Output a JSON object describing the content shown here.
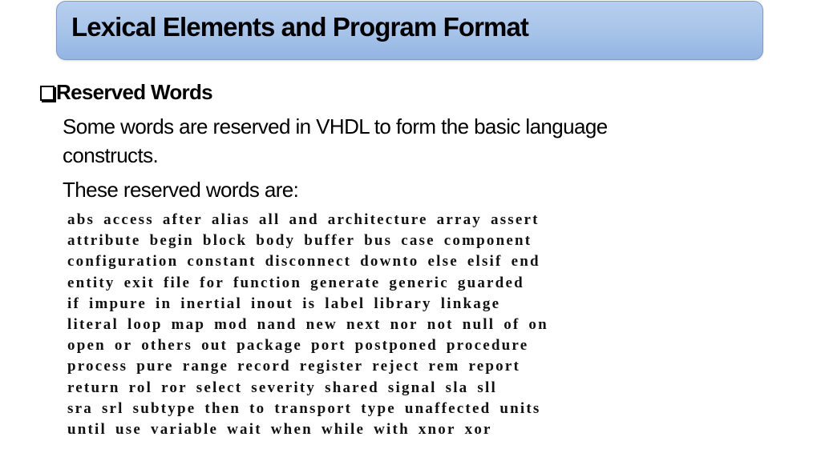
{
  "slide": {
    "title": "Lexical Elements and Program Format",
    "section": {
      "bullet_icon": "checkbox-square-icon",
      "heading": "Reserved Words",
      "description_lines": [
        "Some words are reserved in VHDL to form the basic language",
        "constructs."
      ],
      "intro": "These reserved words are:"
    },
    "reserved_word_rows": [
      [
        "abs",
        "access",
        "after",
        "alias",
        "all",
        "and",
        "architecture",
        "array",
        "assert"
      ],
      [
        "attribute",
        "begin",
        "block",
        "body",
        "buffer",
        "bus",
        "case",
        "component"
      ],
      [
        "configuration",
        "constant",
        "disconnect",
        "downto",
        "else",
        "elsif",
        "end"
      ],
      [
        "entity",
        "exit",
        "file",
        "for",
        "function",
        "generate",
        "generic",
        "guarded"
      ],
      [
        "if",
        "impure",
        "in",
        "inertial",
        "inout",
        "is",
        "label",
        "library",
        "linkage"
      ],
      [
        "literal",
        "loop",
        "map",
        "mod",
        "nand",
        "new",
        "next",
        "nor",
        "not",
        "null",
        "of",
        "on"
      ],
      [
        "open",
        "or",
        "others",
        "out",
        "package",
        "port",
        "postponed",
        "procedure"
      ],
      [
        "process",
        "pure",
        "range",
        "record",
        "register",
        "reject",
        "rem",
        "report"
      ],
      [
        "return",
        "rol",
        "ror",
        "select",
        "severity",
        "shared",
        "signal",
        "sla",
        "sll"
      ],
      [
        "sra",
        "srl",
        "subtype",
        "then",
        "to",
        "transport",
        "type",
        "unaffected",
        "units"
      ],
      [
        "until",
        "use",
        "variable",
        "wait",
        "when",
        "while",
        "with",
        "xnor",
        "xor"
      ]
    ]
  }
}
